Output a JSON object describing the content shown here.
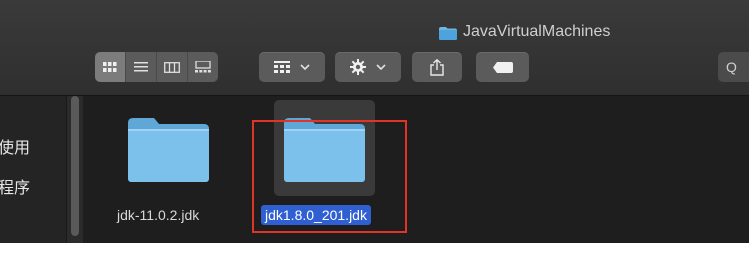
{
  "window": {
    "title": "JavaVirtualMachines"
  },
  "toolbar": {
    "view_modes": [
      "icon-view-icon",
      "list-view-icon",
      "column-view-icon",
      "gallery-view-icon"
    ],
    "active_view": "icon-view-icon",
    "group_button_icon": "grid-group-icon",
    "action_button_icon": "gear-icon",
    "share_button_icon": "share-icon",
    "tag_button_icon": "tag-icon",
    "search_label": "Q"
  },
  "sidebar": {
    "items": [
      {
        "label": "使用"
      },
      {
        "label": "程序"
      }
    ]
  },
  "files": [
    {
      "name": "jdk-11.0.2.jdk",
      "selected": false
    },
    {
      "name": "jdk1.8.0_201.jdk",
      "selected": true
    }
  ],
  "colors": {
    "selection": "#2f5fd0",
    "highlight_box": "#e03428",
    "folder": "#6fb6e4"
  }
}
